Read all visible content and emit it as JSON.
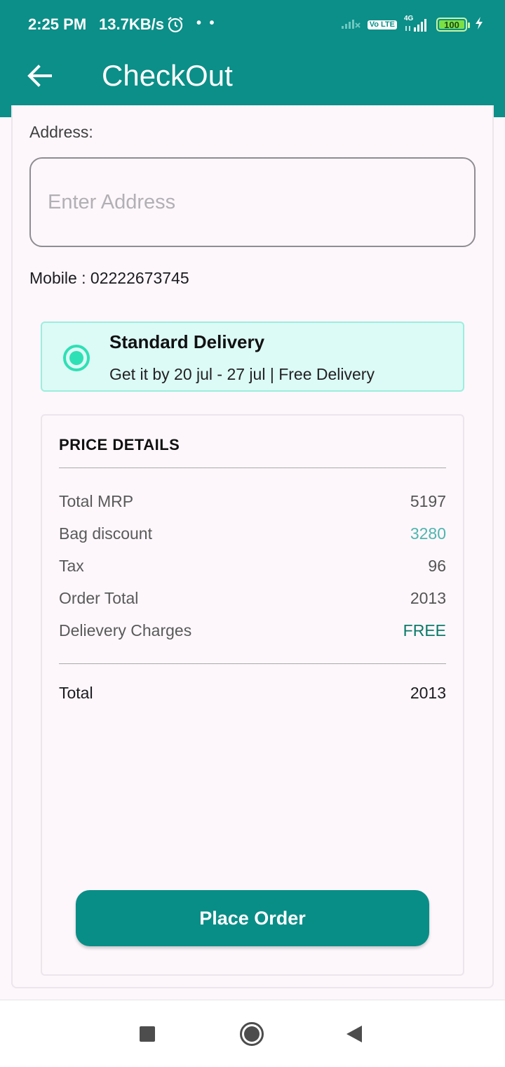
{
  "status_bar": {
    "time": "2:25 PM",
    "net_speed": "13.7KB/s",
    "dots": "• •",
    "lte_label": "Vo LTE",
    "network_label": "4G",
    "battery": "100"
  },
  "app_bar": {
    "title": "CheckOut",
    "back_icon": "arrow-left-icon",
    "color": "#0b8f88"
  },
  "address": {
    "label": "Address:",
    "placeholder": "Enter Address",
    "value": ""
  },
  "mobile": {
    "text": "Mobile : 02222673745"
  },
  "delivery": {
    "selected": true,
    "title": "Standard Delivery",
    "subtitle": "Get it by 20 jul - 27 jul | Free Delivery"
  },
  "price_details": {
    "title": "PRICE DETAILS",
    "rows": [
      {
        "label": "Total MRP",
        "value": "5197"
      },
      {
        "label": "Bag discount",
        "value": "3280"
      },
      {
        "label": "Tax",
        "value": "96"
      },
      {
        "label": "Order Total",
        "value": "2013"
      },
      {
        "label": "Delievery Charges",
        "value": "FREE"
      }
    ],
    "total": {
      "label": "Total",
      "value": "2013"
    }
  },
  "actions": {
    "place_order": "Place Order"
  },
  "colors": {
    "accent": "#0b8f88",
    "discount": "#4fb5ae",
    "free": "#0b7a67",
    "radio": "#2ee0b5"
  }
}
